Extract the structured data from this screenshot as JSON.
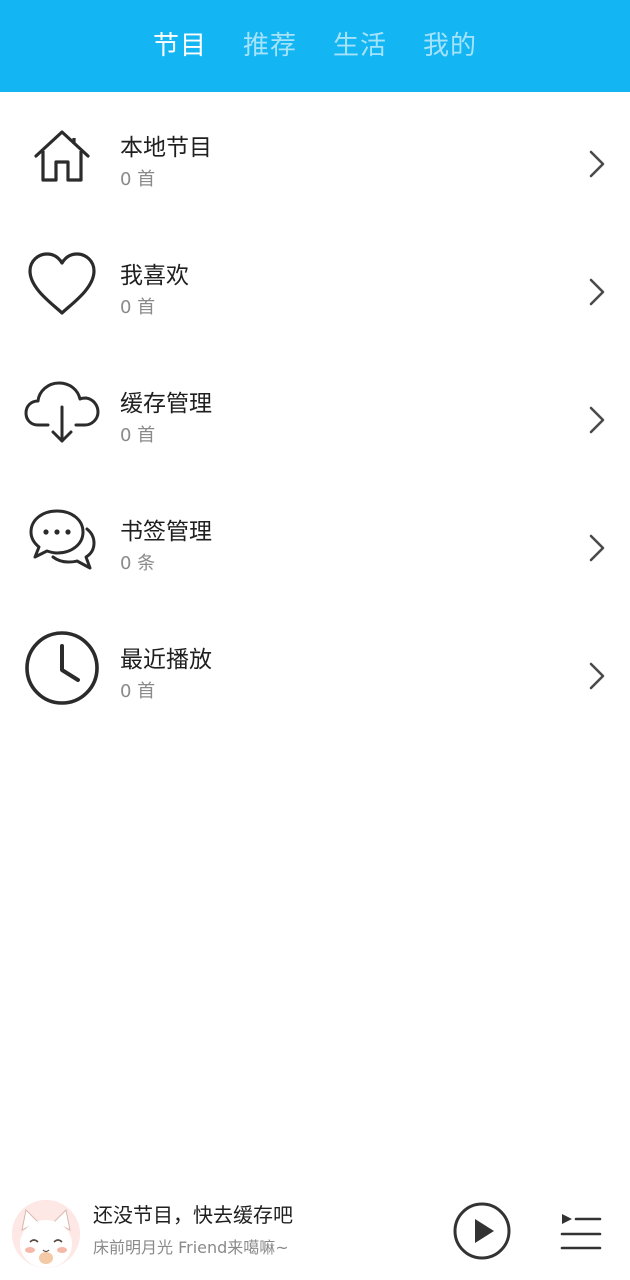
{
  "header": {
    "tabs": [
      {
        "label": "节目",
        "active": true
      },
      {
        "label": "推荐",
        "active": false
      },
      {
        "label": "生活",
        "active": false
      },
      {
        "label": "我的",
        "active": false
      }
    ],
    "background": "#13b5f3"
  },
  "list": {
    "items": [
      {
        "icon": "home-icon",
        "title": "本地节目",
        "sub": "0 首"
      },
      {
        "icon": "heart-icon",
        "title": "我喜欢",
        "sub": "0 首"
      },
      {
        "icon": "cloud-download-icon",
        "title": "缓存管理",
        "sub": "0 首"
      },
      {
        "icon": "chat-bubbles-icon",
        "title": "书签管理",
        "sub": "0 条"
      },
      {
        "icon": "clock-icon",
        "title": "最近播放",
        "sub": "0 首"
      }
    ]
  },
  "player": {
    "title": "还没节目，快去缓存吧",
    "subtitle": "床前明月光 Friend来噶嘛~",
    "avatar": "cat-avatar",
    "play_icon": "play-icon",
    "playlist_icon": "playlist-icon"
  }
}
